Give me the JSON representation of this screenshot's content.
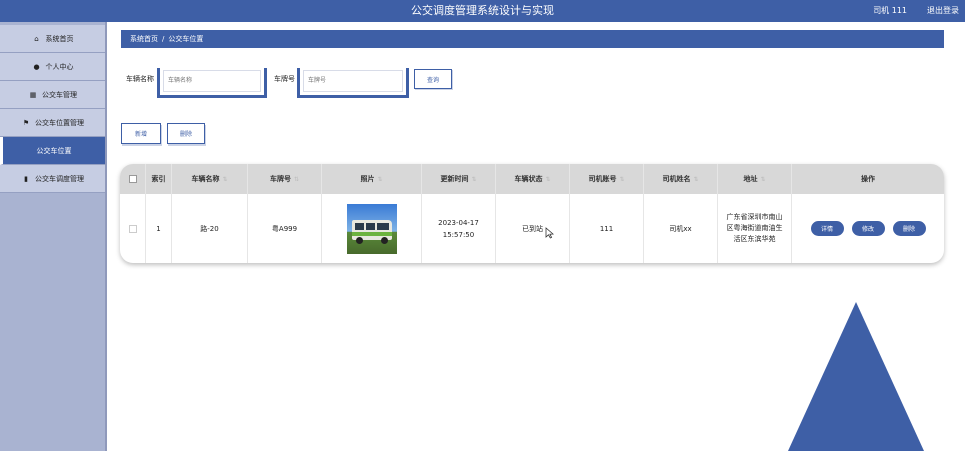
{
  "header": {
    "title": "公交调度管理系统设计与实现",
    "user": "司机 111",
    "logout": "退出登录"
  },
  "sidebar": {
    "items": [
      {
        "label": "系统首页",
        "icon": "home-icon"
      },
      {
        "label": "个人中心",
        "icon": "user-icon"
      },
      {
        "label": "公交车管理",
        "icon": "grid-icon"
      },
      {
        "label": "公交车位置管理",
        "icon": "flag-icon"
      },
      {
        "label": "公交车位置",
        "icon": "",
        "active": true
      },
      {
        "label": "公交车调度管理",
        "icon": "chart-icon"
      }
    ]
  },
  "breadcrumb": {
    "home": "系统首页",
    "separator": "/",
    "current": "公交车位置"
  },
  "search": {
    "vehicle_name_label": "车辆名称",
    "vehicle_name_placeholder": "车辆名称",
    "plate_label": "车牌号",
    "plate_placeholder": "车牌号",
    "query_button": "查询"
  },
  "actions": {
    "add": "新增",
    "delete": "删除"
  },
  "table": {
    "columns": [
      "索引",
      "车辆名称",
      "车牌号",
      "照片",
      "更新时间",
      "车辆状态",
      "司机账号",
      "司机姓名",
      "地址",
      "操作"
    ],
    "rows": [
      {
        "index": "1",
        "vehicle_name": "路-20",
        "plate": "粤A999",
        "update_time": "2023-04-17 15:57:50",
        "status": "已到站",
        "driver_account": "111",
        "driver_name": "司机xx",
        "address": "广东省深圳市南山区粤海街道南油生活区东滨华苑",
        "ops": {
          "detail": "详情",
          "edit": "修改",
          "delete": "删除"
        }
      }
    ]
  },
  "colors": {
    "primary": "#3e5fa6",
    "sidebar": "#a9b3d1",
    "table_header": "#d8d8d8"
  }
}
